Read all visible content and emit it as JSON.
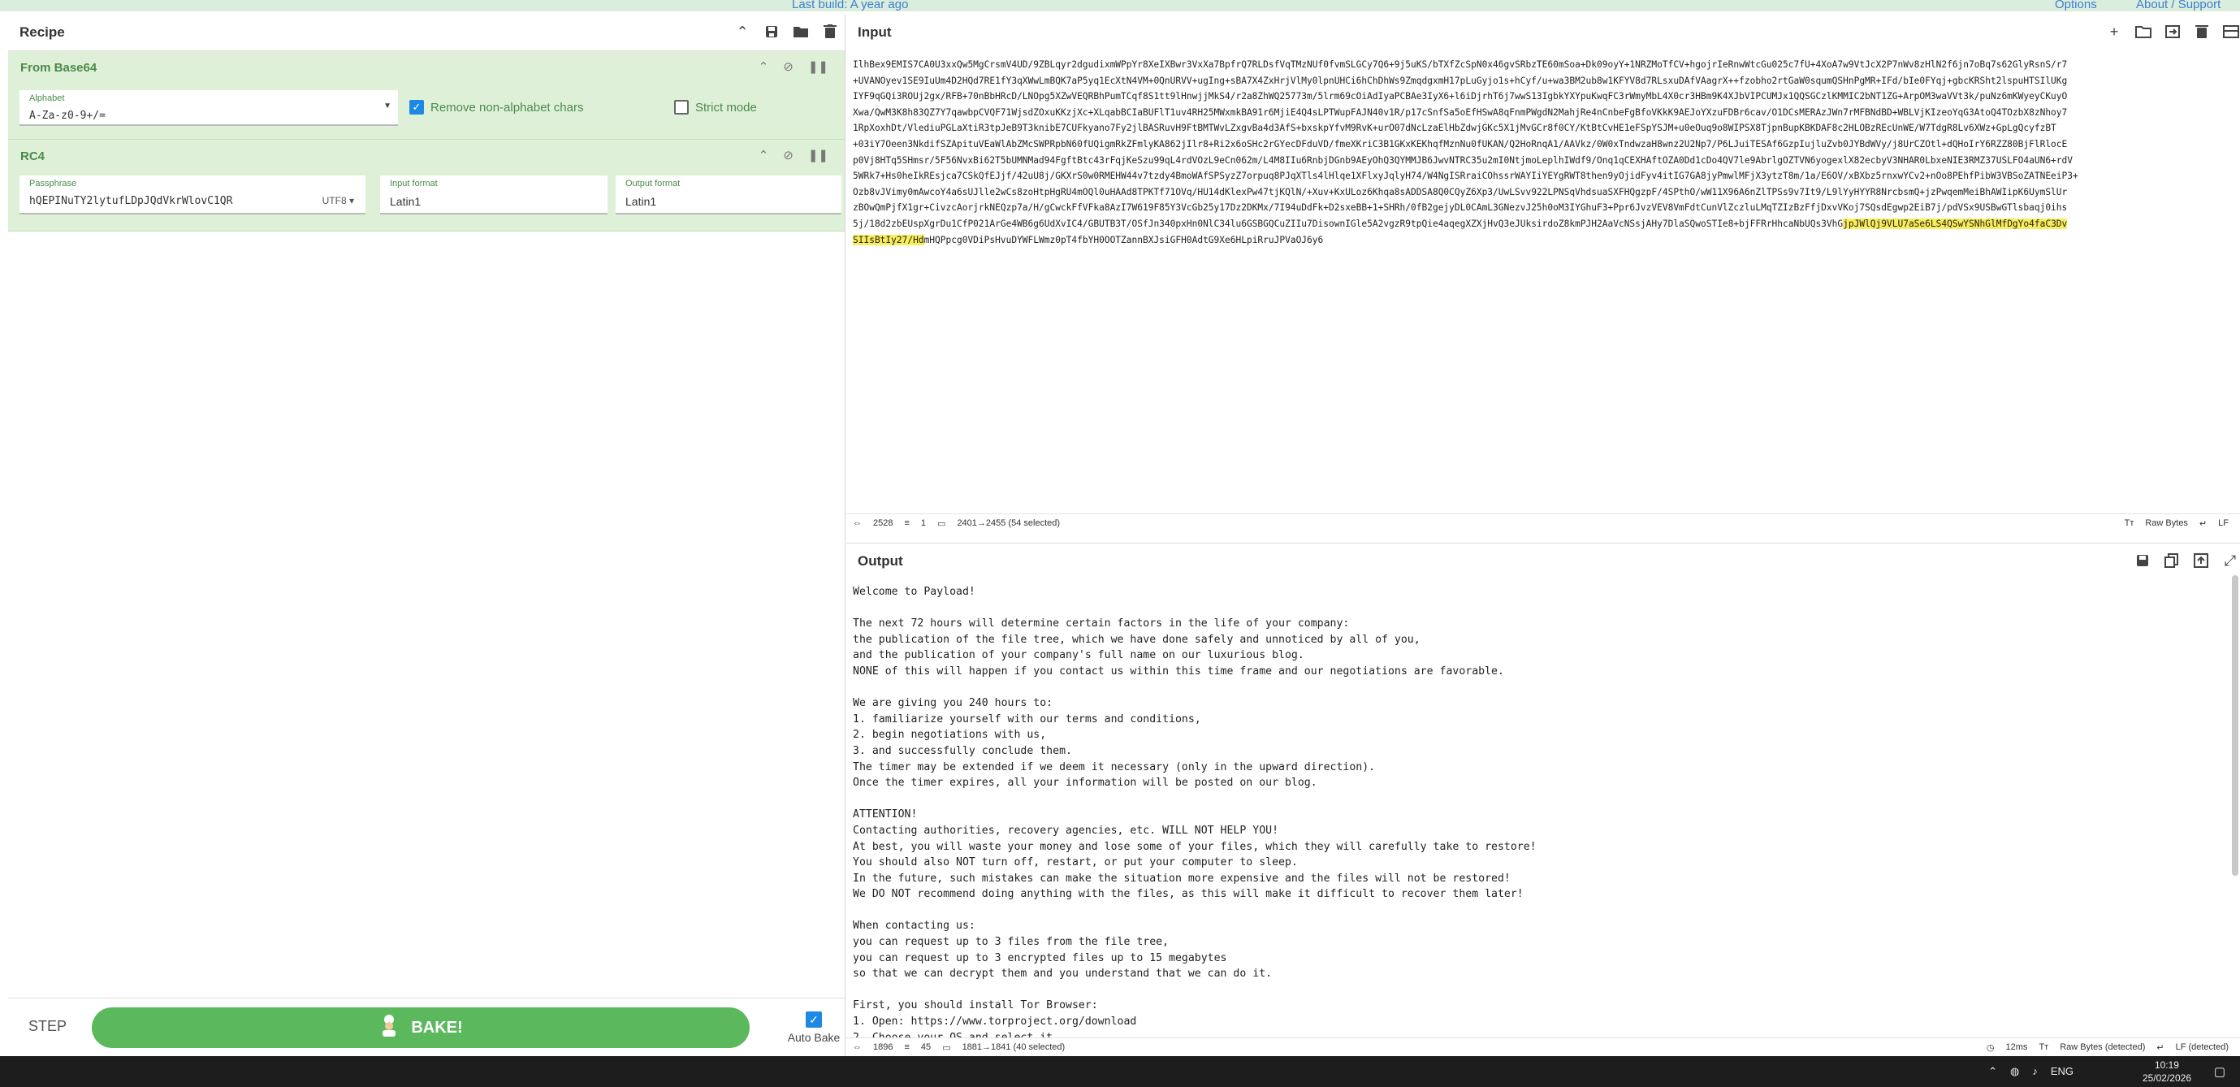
{
  "topbar": {
    "last_build": "Last build: A year ago",
    "options": "Options",
    "about": "About / Support"
  },
  "recipe": {
    "title": "Recipe",
    "ops": [
      {
        "name": "From Base64",
        "alphabet_label": "Alphabet",
        "alphabet_value": "A-Za-z0-9+/=",
        "remove_label": "Remove non-alphabet chars",
        "strict_label": "Strict mode"
      },
      {
        "name": "RC4",
        "passphrase_label": "Passphrase",
        "passphrase_value": "hQEPINuTY2lytufLDpJQdVkrWlovC1QR",
        "passphrase_encoding": "UTF8",
        "input_format_label": "Input format",
        "input_format_value": "Latin1",
        "output_format_label": "Output format",
        "output_format_value": "Latin1"
      }
    ],
    "step_label": "STEP",
    "bake_label": "BAKE!",
    "auto_bake_label": "Auto Bake"
  },
  "input": {
    "title": "Input",
    "text_before": "IlhBex9EMIS7CA0U3xxQw5MgCrsmV4UD/9ZBLqyr2dgudixmWPpYr8XeIXBwr3VxXa7BpfrQ7RLDsfVqTMzNUf0fvmSLGCy7Q6+9j5uKS/bTXfZcSpN0x46gvSRbzTE60mSoa+Dk09oyY+1NRZMoTfCV+hgojrIeRnwWtcGu025c7fU+4XoA7w9VtJcX2P7nWv8zHlN2f6jn7oBq7s62GlyRsnS/r7\n+UVANOyev1SE9IuUm4D2HQd7RE1fY3qXWwLmBQK7aP5yq1EcXtN4VM+0QnURVV+ugIng+sBA7X4ZxHrjVlMy0lpnUHCi6hChDhWs9ZmqdgxmH17pLuGyjo1s+hCyf/u+wa3BM2ub8w1KFYV8d7RLsxuDAfVAagrX++fzobho2rtGaW0squmQSHnPgMR+IFd/bIe0FYqj+gbcKRSht2lspuHTSIlUKg\nIYF9qGQi3ROUj2gx/RFB+70nBbHRcD/LNOpg5XZwVEQRBhPumTCqf8S1tt9lHnwjjMkS4/r2a8ZhWQ25773m/5lrm69cOiAdIyaPCBAe3IyX6+l6iDjrhT6j7wwS13IgbkYXYpuKwqFC3rWmyMbL4X0cr3HBm9K4XJbVIPCUMJx1QQSGCzlKMMIC2bNT1ZG+ArpOM3waVVt3k/puNz6mKWyeyCKuyO\nXwa/QwM3K8h83QZ7Y7qawbpCVQF71WjsdZOxuKKzjXc+XLqabBCIaBUFlT1uv4RH25MWxmkBA91r6MjiE4Q4sLPTWupFAJN40v1R/p17cSnfSa5oEfHSwA8qFnmPWgdN2MahjRe4nCnbeFgBfoVKkK9AEJoYXzuFDBr6cav/O1DCsMERAzJWn7rMFBNdBD+WBLVjKIzeoYqG3AtoQ4TOzbX8zNhoy7\n1RpXoxhDt/VlediuPGLaXtiR3tpJeB9T3knibE7CUFkyano7Fy2jlBASRuvH9FtBMTWvLZxgvBa4d3AfS+bxskpYfvM9RvK+urO07dNcLzaElHbZdwjGKc5X1jMvGCr8f0CY/KtBtCvHE1eFSpYSJM+u0eOuq9o8WIPSX8TjpnBupKBKDAF8c2HLOBzREcUnWE/W7TdgR8Lv6XWz+GpLgQcyfzBT\n+03iY7Oeen3NkdifSZApituVEaWlAbZMcSWPRpbN60fUQigmRkZFmlyKA862jIlr8+Ri2x6oSHc2rGYecDFduVD/fmeXKriC3B1GKxKEKhqfMznNu0fUKAN/Q2HoRnqA1/AAVkz/0W0xTndwzaH8wnz2U2Np7/P6LJuiTESAf6GzpIujluZvb0JYBdWVy/j8UrCZOtl+dQHoIrY6RZZ80BjFlRlocE\np0Vj8HTq5SHmsr/5F56NvxBi62T5bUMNMad94FgftBtc43rFqjKeSzu99qL4rdVOzL9eCn062m/L4M8IIu6RnbjDGnb9AEyOhQ3QYMMJB6JwvNTRC35u2mI0NtjmoLeplhIWdf9/Onq1qCEXHAftOZA0Dd1cDo4QV7le9AbrlgOZTVN6yogexlX82ecbyV3NHAR0LbxeNIE3RMZ37USLFO4aUN6+rdV\n5WRk7+Hs0heIkREsjca7CSkQfEJjf/42uU8j/GKXrS0w0RMEHW44v7tzdy4BmoWAfSPSyzZ7orpuq8PJqXTls4lHlqe1XFlxyJqlyH74/W4NgISRraiCOhssrWAYIiYEYgRWT8then9yOjidFyv4itIG7GA8jyPmwlMFjX3ytzT8m/1a/E6OV/xBXbz5rnxwYCv2+nOo8PEhfPibW3VBSoZATNEeiP3+\nOzb8vJVimy0mAwcoY4a6sUJlle2wCs8zoHtpHgRU4mOQl0uHAAd8TPKTf71OVq/HU14dKlexPw47tjKQlN/+Xuv+KxULoz6Khqa8sADDSA8Q0CQyZ6Xp3/UwLSvv922LPNSqVhdsuaSXFHQgzpF/4SPthO/wW11X96A6nZlTPSs9v7It9/L9lYyHYYR8NrcbsmQ+jzPwqemMeiBhAWIipK6UymSlUr\nzBOwQmPjfX1gr+CivzcAorjrkNEQzp7a/H/gCwckFfVFka8AzI7W619F85Y3VcGb25y17Dz2DKMx/7I94uDdFk+D2sxeBB+1+SHRh/0fB2gejyDL0CAmL3GNezvJ25h0oM3IYGhuF3+Ppr6JvzVEV8VmFdtCunVlZczluLMqTZIzBzFfjDxvVKoj7SQsdEgwp2EiB7j/pdVSx9USBwGTlsbaqj0ihs\n5j/18d2zbEUspXgrDu1CfP021ArGe4WB6g6UdXvIC4/GBUTB3T/OSfJn340pxHn0NlC34lu6GSBGQCuZIIu7DisownIGle5A2vgzR9tpQie4aqegXZXjHvQ3eJUksirdoZ8kmPJH2AaVcNSsjAHy7DlaSQwoSTIe8+bjFFRrHhcaNbUQs3VhG",
    "text_selected_1": "jpJWlQj9VLU7aSe6LS4QSwYSNhGlMfDgYo4faC3Dv",
    "text_selected_2": "SIIsBtIy27/Hd",
    "text_after": "mHQPpcg0VDiPsHvuDYWFLWmz0pT4fbYH0OOTZannBXJsiGFH0AdtG9Xe6HLpiRruJPVaOJ6y6",
    "status": {
      "length": "2528",
      "lines": "1",
      "selection": "2401→2455 (54 selected)",
      "raw_bytes": "Raw Bytes",
      "lf": "LF"
    }
  },
  "output": {
    "title": "Output",
    "text": "Welcome to Payload!\n\nThe next 72 hours will determine certain factors in the life of your company:\nthe publication of the file tree, which we have done safely and unnoticed by all of you,\nand the publication of your company's full name on our luxurious blog.\nNONE of this will happen if you contact us within this time frame and our negotiations are favorable.\n\nWe are giving you 240 hours to:\n1. familiarize yourself with our terms and conditions,\n2. begin negotiations with us,\n3. and successfully conclude them.\nThe timer may be extended if we deem it necessary (only in the upward direction).\nOnce the timer expires, all your information will be posted on our blog.\n\nATTENTION!\nContacting authorities, recovery agencies, etc. WILL NOT HELP YOU!\nAt best, you will waste your money and lose some of your files, which they will carefully take to restore!\nYou should also NOT turn off, restart, or put your computer to sleep.\nIn the future, such mistakes can make the situation more expensive and the files will not be restored!\nWe DO NOT recommend doing anything with the files, as this will make it difficult to recover them later!\n\nWhen contacting us:\nyou can request up to 3 files from the file tree,\nyou can request up to 3 encrypted files up to 15 megabytes\nso that we can decrypt them and you understand that we can do it.\n\nFirst, you should install Tor Browser:\n1. Open: https://www.torproject.org/download\n2. Choose your OS and select it",
    "status": {
      "length": "1896",
      "lines": "45",
      "selection": "1881→1841 (40 selected)",
      "time": "12ms",
      "raw_bytes": "Raw Bytes (detected)",
      "lf": "LF (detected)"
    }
  },
  "taskbar": {
    "lang": "ENG",
    "time": "10:19",
    "date": "25/02/2026"
  }
}
